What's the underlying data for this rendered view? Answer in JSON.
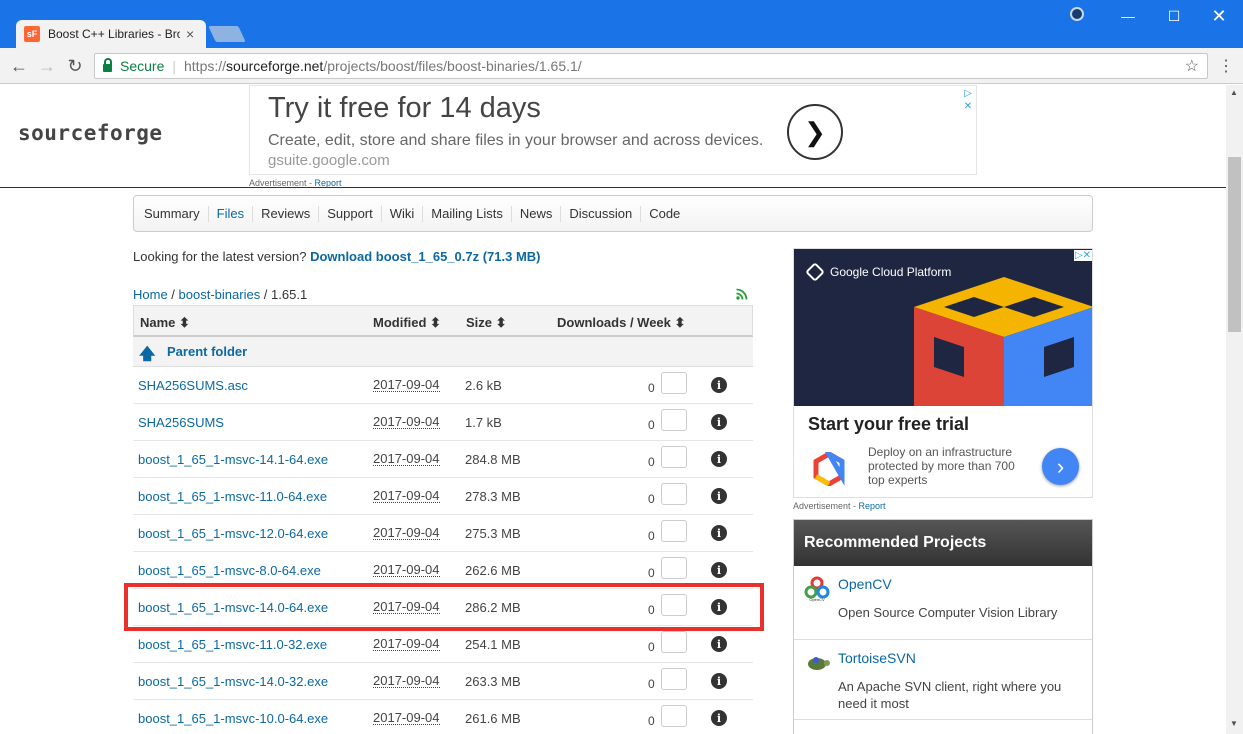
{
  "browser": {
    "tab_title": "Boost C++ Libraries - Bro",
    "tab_favicon": "sF",
    "secure_label": "Secure",
    "url_scheme": "https://",
    "url_host": "sourceforge.net",
    "url_path": "/projects/boost/files/boost-binaries/1.65.1/"
  },
  "header": {
    "logo": "sourceforge",
    "ad": {
      "title": "Try it free for 14 days",
      "description": "Create, edit, store and share files in your browser and across devices.",
      "domain": "gsuite.google.com",
      "label": "Advertisement - ",
      "report": "Report"
    }
  },
  "project_nav": [
    "Summary",
    "Files",
    "Reviews",
    "Support",
    "Wiki",
    "Mailing Lists",
    "News",
    "Discussion",
    "Code"
  ],
  "latest": {
    "prefix": "Looking for the latest version?",
    "link": "Download boost_1_65_0.7z (71.3 MB)"
  },
  "breadcrumb": {
    "home": "Home",
    "sep": " / ",
    "folder": "boost-binaries",
    "current": "1.65.1"
  },
  "table": {
    "headers": {
      "name": "Name ⬍",
      "modified": "Modified ⬍",
      "size": "Size ⬍",
      "downloads": "Downloads / Week ⬍"
    },
    "parent": "Parent folder",
    "rows": [
      {
        "name": "SHA256SUMS.asc",
        "date": "2017-09-04",
        "size": "2.6 kB",
        "dl": "0"
      },
      {
        "name": "SHA256SUMS",
        "date": "2017-09-04",
        "size": "1.7 kB",
        "dl": "0"
      },
      {
        "name": "boost_1_65_1-msvc-14.1-64.exe",
        "date": "2017-09-04",
        "size": "284.8 MB",
        "dl": "0"
      },
      {
        "name": "boost_1_65_1-msvc-11.0-64.exe",
        "date": "2017-09-04",
        "size": "278.3 MB",
        "dl": "0"
      },
      {
        "name": "boost_1_65_1-msvc-12.0-64.exe",
        "date": "2017-09-04",
        "size": "275.3 MB",
        "dl": "0"
      },
      {
        "name": "boost_1_65_1-msvc-8.0-64.exe",
        "date": "2017-09-04",
        "size": "262.6 MB",
        "dl": "0"
      },
      {
        "name": "boost_1_65_1-msvc-14.0-64.exe",
        "date": "2017-09-04",
        "size": "286.2 MB",
        "dl": "0"
      },
      {
        "name": "boost_1_65_1-msvc-11.0-32.exe",
        "date": "2017-09-04",
        "size": "254.1 MB",
        "dl": "0"
      },
      {
        "name": "boost_1_65_1-msvc-14.0-32.exe",
        "date": "2017-09-04",
        "size": "263.3 MB",
        "dl": "0"
      },
      {
        "name": "boost_1_65_1-msvc-10.0-64.exe",
        "date": "2017-09-04",
        "size": "261.6 MB",
        "dl": "0"
      }
    ]
  },
  "side_ad": {
    "brand": "Google Cloud Platform",
    "headline": "Start your free trial",
    "text": "Deploy on an infrastructure protected by more than 700 top experts",
    "label": "Advertisement - ",
    "report": "Report"
  },
  "recommended": {
    "title": "Recommended Projects",
    "items": [
      {
        "name": "OpenCV",
        "desc": "Open Source Computer Vision Library",
        "icon": "opencv-icon",
        "icon_text": "OpenCV"
      },
      {
        "name": "TortoiseSVN",
        "desc": "An Apache SVN client, right where you need it most",
        "icon": "tortoise-icon"
      }
    ]
  },
  "colors": {
    "accent": "#0b68a3",
    "chrome_blue": "#1b73e8",
    "highlight": "#e8312c"
  }
}
